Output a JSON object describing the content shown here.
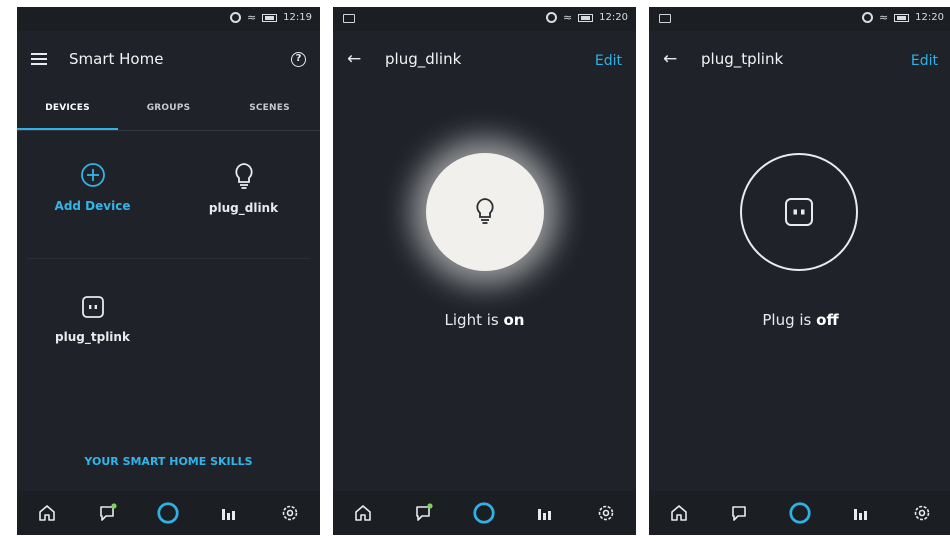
{
  "screens": [
    {
      "status_time": "12:19",
      "title": "Smart Home",
      "tabs": [
        "DEVICES",
        "GROUPS",
        "SCENES"
      ],
      "devices": [
        {
          "label": "Add Device",
          "icon": "add-circle-icon"
        },
        {
          "label": "plug_dlink",
          "icon": "lightbulb-icon"
        },
        {
          "label": "plug_tplink",
          "icon": "plug-icon"
        }
      ],
      "skills_link": "YOUR SMART HOME SKILLS"
    },
    {
      "status_time": "12:20",
      "title": "plug_dlink",
      "edit_label": "Edit",
      "state_prefix": "Light is ",
      "state_value": "on"
    },
    {
      "status_time": "12:20",
      "title": "plug_tplink",
      "edit_label": "Edit",
      "state_prefix": "Plug is ",
      "state_value": "off"
    }
  ],
  "bottom_nav": [
    "home-icon",
    "chat-icon",
    "alexa-icon",
    "activity-icon",
    "settings-icon"
  ],
  "colors": {
    "accent": "#2fb1e6",
    "background": "#1f2329",
    "green_dot": "#7cd35b"
  }
}
